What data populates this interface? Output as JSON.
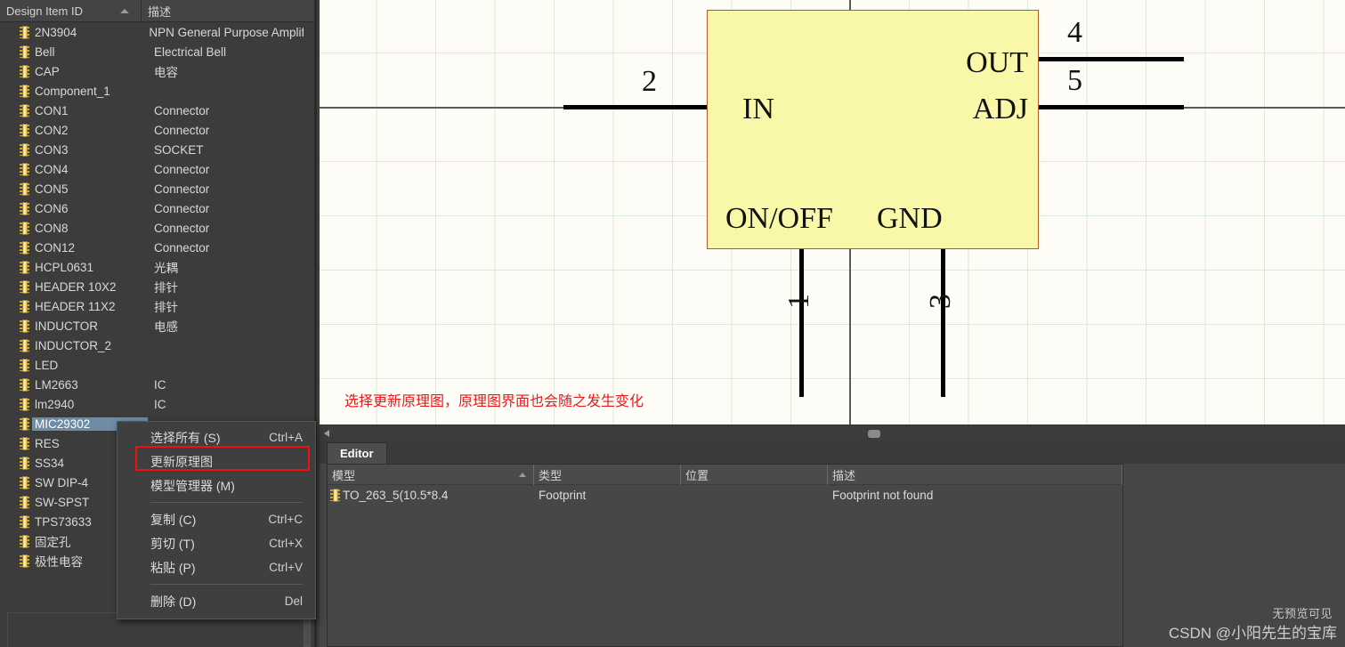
{
  "left_panel": {
    "columns": [
      {
        "label": "Design Item ID",
        "sorted": "asc"
      },
      {
        "label": "描述"
      }
    ],
    "items": [
      {
        "name": "2N3904",
        "desc": "NPN General Purpose Amplifie"
      },
      {
        "name": "Bell",
        "desc": "Electrical Bell"
      },
      {
        "name": "CAP",
        "desc": "电容"
      },
      {
        "name": "Component_1",
        "desc": ""
      },
      {
        "name": "CON1",
        "desc": "Connector"
      },
      {
        "name": "CON2",
        "desc": "Connector"
      },
      {
        "name": "CON3",
        "desc": "SOCKET"
      },
      {
        "name": "CON4",
        "desc": "Connector"
      },
      {
        "name": "CON5",
        "desc": "Connector"
      },
      {
        "name": "CON6",
        "desc": "Connector"
      },
      {
        "name": "CON8",
        "desc": "Connector"
      },
      {
        "name": "CON12",
        "desc": "Connector"
      },
      {
        "name": "HCPL0631",
        "desc": "光耦"
      },
      {
        "name": "HEADER 10X2",
        "desc": "排针"
      },
      {
        "name": "HEADER 11X2",
        "desc": "排针"
      },
      {
        "name": "INDUCTOR",
        "desc": "电感"
      },
      {
        "name": "INDUCTOR_2",
        "desc": ""
      },
      {
        "name": "LED",
        "desc": ""
      },
      {
        "name": "LM2663",
        "desc": "IC"
      },
      {
        "name": "lm2940",
        "desc": "IC"
      },
      {
        "name": "MIC29302",
        "desc": "",
        "selected": true
      },
      {
        "name": "RES",
        "desc": ""
      },
      {
        "name": "SS34",
        "desc": ""
      },
      {
        "name": "SW DIP-4",
        "desc": ""
      },
      {
        "name": "SW-SPST",
        "desc": ""
      },
      {
        "name": "TPS73633",
        "desc": ""
      },
      {
        "name": "固定孔",
        "desc": ""
      },
      {
        "name": "极性电容",
        "desc": ""
      }
    ]
  },
  "context_menu": {
    "items": [
      {
        "label": "选择所有 (S)",
        "shortcut": "Ctrl+A",
        "underline": "S",
        "highlighted": false
      },
      {
        "label": "更新原理图",
        "shortcut": "",
        "underline": "",
        "highlighted": true
      },
      {
        "label": "模型管理器 (M)",
        "shortcut": "",
        "underline": "M",
        "highlighted": false
      },
      {
        "separator": true
      },
      {
        "label": "复制 (C)",
        "shortcut": "Ctrl+C",
        "underline": "C",
        "highlighted": false
      },
      {
        "label": "剪切 (T)",
        "shortcut": "Ctrl+X",
        "underline": "T",
        "highlighted": false
      },
      {
        "label": "粘贴 (P)",
        "shortcut": "Ctrl+V",
        "underline": "P",
        "highlighted": false
      },
      {
        "separator": true
      },
      {
        "label": "删除 (D)",
        "shortcut": "Del",
        "underline": "D",
        "highlighted": false
      }
    ],
    "highlight_color": "#ee1111"
  },
  "canvas": {
    "symbol": {
      "fill_color": "#f8f8a8",
      "border_color": "#b05a28",
      "pin_labels": {
        "in": "IN",
        "out": "OUT",
        "adj": "ADJ",
        "onoff": "ON/OFF",
        "gnd": "GND"
      },
      "pin_numbers": {
        "in": "2",
        "out": "4",
        "adj": "5",
        "onoff": "1",
        "gnd": "3"
      }
    },
    "annotation": {
      "text": "选择更新原理图，原理图界面也会随之发生变化",
      "color": "#e81a1a"
    }
  },
  "editor": {
    "tab_label": "Editor",
    "columns": [
      {
        "label": "模型",
        "sorted": "asc"
      },
      {
        "label": "类型"
      },
      {
        "label": "位置"
      },
      {
        "label": "描述"
      }
    ],
    "rows": [
      {
        "model": "TO_263_5(10.5*8.4",
        "type": "Footprint",
        "location": "",
        "description": "Footprint not found"
      }
    ]
  },
  "watermark": {
    "top": "无预览可见",
    "bottom": "CSDN @小阳先生的宝库"
  }
}
